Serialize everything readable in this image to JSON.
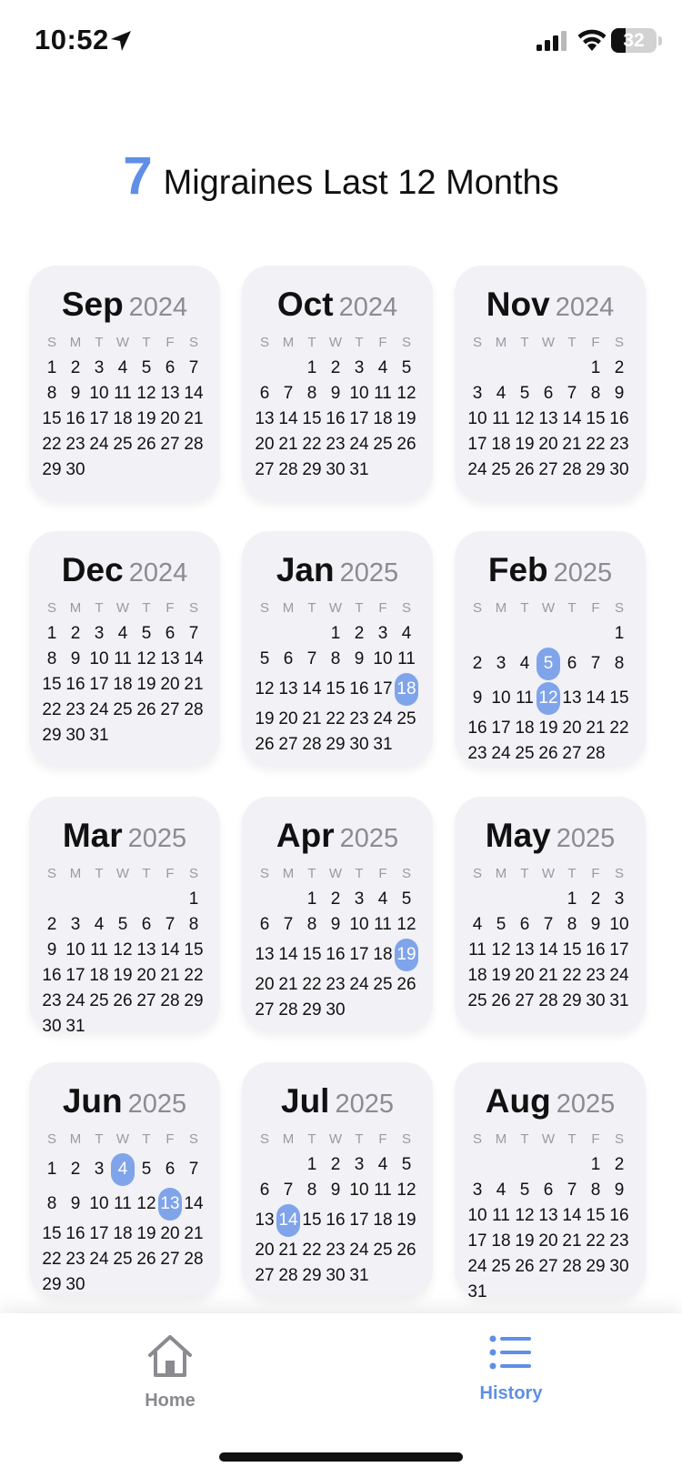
{
  "status_bar": {
    "time": "10:52",
    "battery": "32",
    "battery_level_percent": 32
  },
  "headline": {
    "count": "7",
    "text": "Migraines Last 12 Months"
  },
  "colors": {
    "accent": "#5f8fe6",
    "marker": "#7fa4ea",
    "card": "#f1f1f6",
    "muted": "#8b8b91"
  },
  "weekday_labels": [
    "S",
    "M",
    "T",
    "W",
    "T",
    "F",
    "S"
  ],
  "months": [
    {
      "name": "Sep",
      "year": "2024",
      "first_weekday": 0,
      "days": 30,
      "migraine_days": []
    },
    {
      "name": "Oct",
      "year": "2024",
      "first_weekday": 2,
      "days": 31,
      "migraine_days": []
    },
    {
      "name": "Nov",
      "year": "2024",
      "first_weekday": 5,
      "days": 30,
      "migraine_days": []
    },
    {
      "name": "Dec",
      "year": "2024",
      "first_weekday": 0,
      "days": 31,
      "migraine_days": []
    },
    {
      "name": "Jan",
      "year": "2025",
      "first_weekday": 3,
      "days": 31,
      "migraine_days": [
        18
      ]
    },
    {
      "name": "Feb",
      "year": "2025",
      "first_weekday": 6,
      "days": 28,
      "migraine_days": [
        5,
        12
      ]
    },
    {
      "name": "Mar",
      "year": "2025",
      "first_weekday": 6,
      "days": 31,
      "migraine_days": []
    },
    {
      "name": "Apr",
      "year": "2025",
      "first_weekday": 2,
      "days": 30,
      "migraine_days": [
        19
      ]
    },
    {
      "name": "May",
      "year": "2025",
      "first_weekday": 4,
      "days": 31,
      "migraine_days": []
    },
    {
      "name": "Jun",
      "year": "2025",
      "first_weekday": 0,
      "days": 30,
      "migraine_days": [
        4,
        13
      ]
    },
    {
      "name": "Jul",
      "year": "2025",
      "first_weekday": 2,
      "days": 31,
      "migraine_days": [
        14
      ]
    },
    {
      "name": "Aug",
      "year": "2025",
      "first_weekday": 5,
      "days": 31,
      "migraine_days": []
    }
  ],
  "tabs": [
    {
      "label": "Home",
      "icon": "house-icon",
      "selected": false
    },
    {
      "label": "History",
      "icon": "list-icon",
      "selected": true
    }
  ]
}
